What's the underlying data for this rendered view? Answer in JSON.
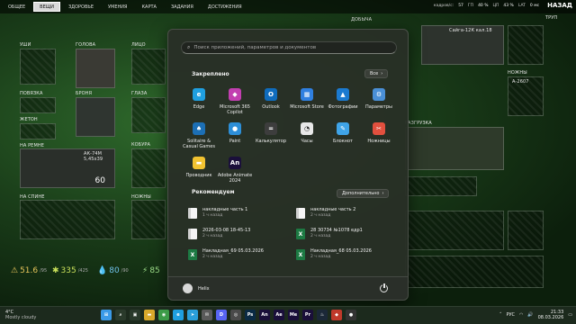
{
  "game": {
    "tabs": [
      {
        "label": "ОБЩЕЕ",
        "active": false
      },
      {
        "label": "ВЕЩИ",
        "active": true
      },
      {
        "label": "ЗДОРОВЬЕ",
        "active": false
      },
      {
        "label": "УМЕНИЯ",
        "active": false
      },
      {
        "label": "КАРТА",
        "active": false
      },
      {
        "label": "ЗАДАНИЯ",
        "active": false
      },
      {
        "label": "ДОСТИЖЕНИЯ",
        "active": false
      }
    ],
    "fps_label": "кадров/с:",
    "fps_value": "57",
    "gpu_label": "ГП",
    "gpu_value": "40 %",
    "cpu_label": "ЦП",
    "cpu_value": "43 %",
    "lat_label": "LAT",
    "lat_value": "0 мс",
    "back_label": "НАЗАД",
    "corpse_label": "ТРУП",
    "slots": {
      "ears": "УШИ",
      "head": "ГОЛОВА",
      "face": "ЛИЦО",
      "armband": "ПОВЯЗКА",
      "armor": "БРОНЯ",
      "eyes": "ГЛАЗА",
      "vest": "ЖЕТОН",
      "holster": "КОБУРА",
      "on_belt": "НА РЕМНЕ",
      "on_back": "НА СПИНЕ",
      "knives": "НОЖНЫ",
      "rig": "РАЗГРУЗКА",
      "knives_right": "НОЖНЫ"
    },
    "weapon_name": "АК-74М 5,45х39",
    "weapon_ammo": "60",
    "weapon_right_name": "Сайга-12К кал.18",
    "knife_right_name": "А-2607",
    "tag_label": "ДОБЫЧА",
    "stats": {
      "hydration": "51.6",
      "hydration_max": "/95",
      "energy": "335",
      "energy_max": "/425",
      "weight": "80",
      "weight_max": "/90",
      "speed": "85"
    }
  },
  "start": {
    "search_placeholder": "Поиск приложений, параметров и документов",
    "pinned_title": "Закреплено",
    "all_button": "Все",
    "apps": [
      {
        "label": "Edge",
        "icon": "edge-icon",
        "color": "#1f9fe0",
        "glyph": "e"
      },
      {
        "label": "Microsoft 365 Copilot",
        "icon": "m365-icon",
        "color": "#c23fb0",
        "glyph": "◆"
      },
      {
        "label": "Outlook",
        "icon": "outlook-icon",
        "color": "#0f6cbd",
        "glyph": "O"
      },
      {
        "label": "Microsoft Store",
        "icon": "store-icon",
        "color": "#2f7fe0",
        "glyph": "▦"
      },
      {
        "label": "Фотографии",
        "icon": "photos-icon",
        "color": "#1b7ad0",
        "glyph": "▲"
      },
      {
        "label": "Параметры",
        "icon": "settings-icon",
        "color": "#4a8fd6",
        "glyph": "⚙"
      },
      {
        "label": "Solitaire & Casual Games",
        "icon": "solitaire-icon",
        "color": "#1c6fb5",
        "glyph": "♠"
      },
      {
        "label": "Paint",
        "icon": "paint-icon",
        "color": "#2d8fd8",
        "glyph": "●"
      },
      {
        "label": "Калькулятор",
        "icon": "calculator-icon",
        "color": "#3d3d3d",
        "glyph": "="
      },
      {
        "label": "Часы",
        "icon": "clock-icon",
        "color": "#e8e8e8",
        "glyph": "◔"
      },
      {
        "label": "Блокнот",
        "icon": "notepad-icon",
        "color": "#3fa4e8",
        "glyph": "✎"
      },
      {
        "label": "Ножницы",
        "icon": "scissors-icon",
        "color": "#e2503e",
        "glyph": "✂"
      },
      {
        "label": "Проводник",
        "icon": "explorer-icon",
        "color": "#f2c331",
        "glyph": "▬"
      },
      {
        "label": "Adobe Animate 2024",
        "icon": "animate-icon",
        "color": "#1a0f3a",
        "glyph": "An"
      }
    ],
    "recommended_title": "Рекомендуем",
    "more_button": "Дополнительно",
    "recommended": [
      {
        "name": "накладные часть 1",
        "time": "1 ч назад",
        "type": "doc"
      },
      {
        "name": "накладные часть 2",
        "time": "2 ч назад",
        "type": "doc"
      },
      {
        "name": "2026-03-08 18-45-13",
        "time": "2 ч назад",
        "type": "doc"
      },
      {
        "name": "28 30734 №1078 едр1",
        "time": "2 ч назад",
        "type": "xls"
      },
      {
        "name": "Накладная_69 05.03.2026",
        "time": "2 ч назад",
        "type": "xls"
      },
      {
        "name": "Накладная_68 05.03.2026",
        "time": "2 ч назад",
        "type": "xls"
      }
    ],
    "user_name": "Helix"
  },
  "taskbar": {
    "temp": "4°C",
    "weather": "Mostly cloudy",
    "lang": "РУС",
    "time": "21:33",
    "date": "08.03.2026",
    "icons": [
      {
        "name": "start-icon",
        "color": "#3b9ae8",
        "glyph": "⊞"
      },
      {
        "name": "search-icon",
        "color": "#2a3a2b",
        "glyph": "⌕"
      },
      {
        "name": "taskview-icon",
        "color": "#2a3a2b",
        "glyph": "▣"
      },
      {
        "name": "explorer-icon",
        "color": "#d9a92b",
        "glyph": "▬"
      },
      {
        "name": "chrome-icon",
        "color": "#3c9b48",
        "glyph": "◉"
      },
      {
        "name": "edge-icon",
        "color": "#1f9fe0",
        "glyph": "e"
      },
      {
        "name": "telegram-icon",
        "color": "#2a9ed8",
        "glyph": "➤"
      },
      {
        "name": "mail-icon",
        "color": "#5a5a5a",
        "glyph": "✉"
      },
      {
        "name": "discord-icon",
        "color": "#5865f2",
        "glyph": "D"
      },
      {
        "name": "game-icon",
        "color": "#4a4a4a",
        "glyph": "◎"
      },
      {
        "name": "photoshop-icon",
        "color": "#0a2a44",
        "glyph": "Ps"
      },
      {
        "name": "animate-icon",
        "color": "#1a0f3a",
        "glyph": "An"
      },
      {
        "name": "aftereffects-icon",
        "color": "#1a0f3a",
        "glyph": "Ae"
      },
      {
        "name": "mediaencoder-icon",
        "color": "#1a0f3a",
        "glyph": "Me"
      },
      {
        "name": "premiere-icon",
        "color": "#1a0f3a",
        "glyph": "Pr"
      },
      {
        "name": "steam-icon",
        "color": "#1b2838",
        "glyph": "♨"
      },
      {
        "name": "app-icon",
        "color": "#c0392b",
        "glyph": "◆"
      },
      {
        "name": "obs-icon",
        "color": "#333",
        "glyph": "●"
      }
    ]
  }
}
